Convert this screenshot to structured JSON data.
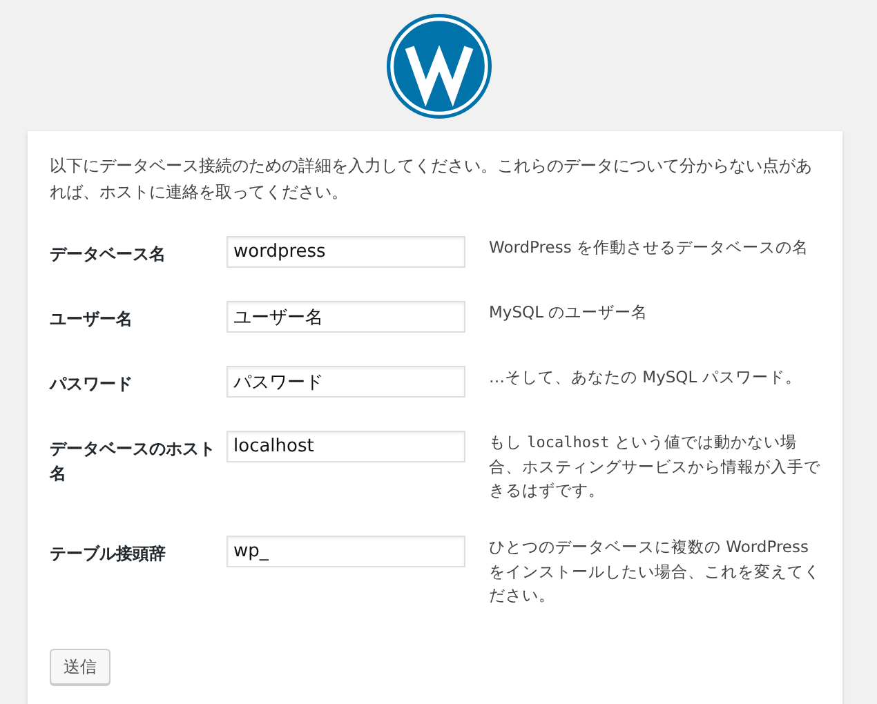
{
  "intro": "以下にデータベース接続のための詳細を入力してください。これらのデータについて分からない点があれば、ホストに連絡を取ってください。",
  "fields": [
    {
      "label": "データベース名",
      "value": "wordpress",
      "help": [
        {
          "kind": "text",
          "text": "WordPress を作動させるデータベースの名"
        }
      ]
    },
    {
      "label": "ユーザー名",
      "value": "ユーザー名",
      "help": [
        {
          "kind": "text",
          "text": "MySQL のユーザー名"
        }
      ]
    },
    {
      "label": "パスワード",
      "value": "パスワード",
      "help": [
        {
          "kind": "text",
          "text": "…そして、あなたの MySQL パスワード。"
        }
      ]
    },
    {
      "label": "データベースのホスト名",
      "value": "localhost",
      "help": [
        {
          "kind": "text",
          "text": "もし "
        },
        {
          "kind": "code",
          "text": "localhost"
        },
        {
          "kind": "text",
          "text": " という値では動かない場合、ホスティングサービスから情報が入手できるはずです。"
        }
      ]
    },
    {
      "label": "テーブル接頭辞",
      "value": "wp_",
      "help": [
        {
          "kind": "text",
          "text": "ひとつのデータベースに複数の WordPress をインストールしたい場合、これを変えてください。"
        }
      ]
    }
  ],
  "submit": "送信"
}
